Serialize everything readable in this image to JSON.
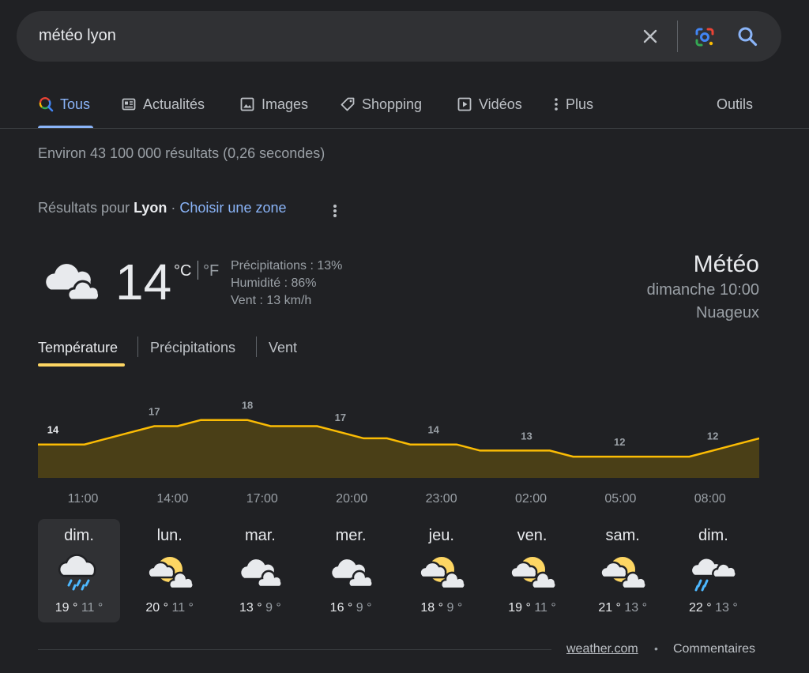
{
  "search": {
    "query": "météo lyon"
  },
  "tabs": [
    {
      "label": "Tous",
      "icon": "search-multicolor-icon"
    },
    {
      "label": "Actualités",
      "icon": "news-icon"
    },
    {
      "label": "Images",
      "icon": "image-icon"
    },
    {
      "label": "Shopping",
      "icon": "tag-icon"
    },
    {
      "label": "Vidéos",
      "icon": "play-icon"
    },
    {
      "label": "Plus",
      "icon": "more-vert-icon"
    }
  ],
  "tools_label": "Outils",
  "stats": "Environ 43 100 000 résultats (0,26 secondes)",
  "location": {
    "prefix": "Résultats pour",
    "city": "Lyon",
    "sep": " · ",
    "choose": "Choisir une zone"
  },
  "current": {
    "temp": "14",
    "unit_c": "°C",
    "unit_f": "°F",
    "precip": "Précipitations : 13%",
    "humidity": "Humidité : 86%",
    "wind": "Vent : 13 km/h",
    "title": "Météo",
    "time": "dimanche 10:00",
    "condition": "Nuageux",
    "icon": "cloudy-icon"
  },
  "chart_tabs": [
    "Température",
    "Précipitations",
    "Vent"
  ],
  "chart_data": {
    "type": "area",
    "series": [
      {
        "values": [
          14,
          14,
          14,
          15,
          16,
          17,
          17,
          18,
          18,
          18,
          17,
          17,
          17,
          16,
          15,
          15,
          14,
          14,
          14,
          13,
          13,
          13,
          13,
          12,
          12,
          12,
          12,
          12,
          12,
          13,
          14,
          15
        ]
      }
    ],
    "labels": [
      {
        "index": 1,
        "value": "14"
      },
      {
        "index": 5,
        "value": "17"
      },
      {
        "index": 9,
        "value": "18"
      },
      {
        "index": 13,
        "value": "17"
      },
      {
        "index": 17,
        "value": "14"
      },
      {
        "index": 21,
        "value": "13"
      },
      {
        "index": 25,
        "value": "12"
      },
      {
        "index": 29,
        "value": "12"
      }
    ],
    "time_labels": [
      "11:00",
      "14:00",
      "17:00",
      "20:00",
      "23:00",
      "02:00",
      "05:00",
      "08:00"
    ],
    "ylim": [
      8,
      19
    ],
    "colors": {
      "line": "#fbbc04",
      "fill": "#4a3f17"
    }
  },
  "forecast": [
    {
      "day": "dim.",
      "hi": "19 °",
      "lo": "11 °",
      "icon": "rain-icon"
    },
    {
      "day": "lun.",
      "hi": "20 °",
      "lo": "11 °",
      "icon": "partly-sunny-icon"
    },
    {
      "day": "mar.",
      "hi": "13 °",
      "lo": "9 °",
      "icon": "cloudy-icon"
    },
    {
      "day": "mer.",
      "hi": "16 °",
      "lo": "9 °",
      "icon": "cloudy-icon"
    },
    {
      "day": "jeu.",
      "hi": "18 °",
      "lo": "9 °",
      "icon": "partly-sunny-icon"
    },
    {
      "day": "ven.",
      "hi": "19 °",
      "lo": "11 °",
      "icon": "partly-sunny-icon"
    },
    {
      "day": "sam.",
      "hi": "21 °",
      "lo": "13 °",
      "icon": "partly-sunny-icon"
    },
    {
      "day": "dim.",
      "hi": "22 °",
      "lo": "13 °",
      "icon": "showers-icon"
    }
  ],
  "footer": {
    "source": "weather.com",
    "dot": "•",
    "feedback": "Commentaires"
  }
}
